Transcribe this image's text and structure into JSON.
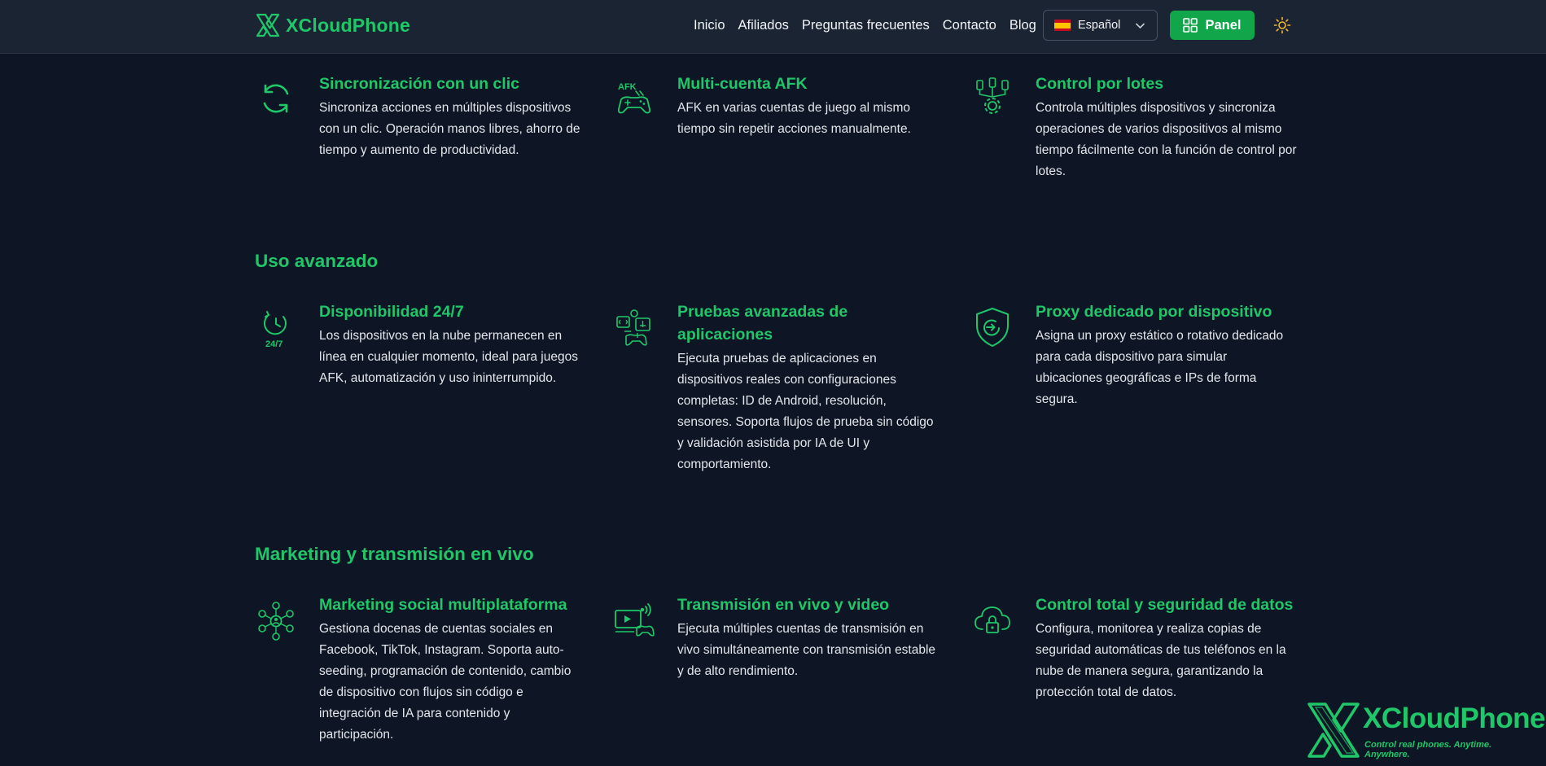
{
  "header": {
    "brand": "XCloudPhone",
    "nav": [
      "Inicio",
      "Afiliados",
      "Preguntas frecuentes",
      "Contacto",
      "Blog"
    ],
    "language": "Español",
    "panel_label": "Panel"
  },
  "sections": [
    {
      "title": "",
      "features": [
        {
          "icon": "sync-icon",
          "title": "Sincronización con un clic",
          "text": "Sincroniza acciones en múltiples dispositivos con un clic. Operación manos libres, ahorro de tiempo y aumento de productividad."
        },
        {
          "icon": "afk-gamepad-icon",
          "icon_label": "AFK",
          "title": "Multi-cuenta AFK",
          "text": "AFK en varias cuentas de juego al mismo tiempo sin repetir acciones manualmente."
        },
        {
          "icon": "batch-control-icon",
          "title": "Control por lotes",
          "text": "Controla múltiples dispositivos y sincroniza operaciones de varios dispositivos al mismo tiempo fácilmente con la función de control por lotes."
        }
      ]
    },
    {
      "title": "Uso avanzado",
      "features": [
        {
          "icon": "clock-24-7-icon",
          "icon_label": "24/7",
          "title": "Disponibilidad 24/7",
          "text": "Los dispositivos en la nube permanecen en línea en cualquier momento, ideal para juegos AFK, automatización y uso ininterrumpido."
        },
        {
          "icon": "app-testing-icon",
          "title": "Pruebas avanzadas de aplicaciones",
          "text": "Ejecuta pruebas de aplicaciones en dispositivos reales con configuraciones completas: ID de Android, resolución, sensores. Soporta flujos de prueba sin código y validación asistida por IA de UI y comportamiento."
        },
        {
          "icon": "shield-proxy-icon",
          "title": "Proxy dedicado por dispositivo",
          "text": "Asigna un proxy estático o rotativo dedicado para cada dispositivo para simular ubicaciones geográficas e IPs de forma segura."
        }
      ]
    },
    {
      "title": "Marketing y transmisión en vivo",
      "features": [
        {
          "icon": "social-network-icon",
          "title": "Marketing social multiplataforma",
          "text": "Gestiona docenas de cuentas sociales en Facebook, TikTok, Instagram. Soporta auto-seeding, programación de contenido, cambio de dispositivo con flujos sin código e integración de IA para contenido y participación."
        },
        {
          "icon": "live-stream-icon",
          "title": "Transmisión en vivo y video",
          "text": "Ejecuta múltiples cuentas de transmisión en vivo simultáneamente con transmisión estable y de alto rendimiento."
        },
        {
          "icon": "cloud-lock-icon",
          "title": "Control total y seguridad de datos",
          "text": "Configura, monitorea y realiza copias de seguridad automáticas de tus teléfonos en la nube de manera segura, garantizando la protección total de datos."
        }
      ]
    }
  ],
  "watermark": {
    "brand": "XCloudPhone",
    "tagline": "Control real phones. Anytime. Anywhere."
  },
  "colors": {
    "accent": "#1fc768",
    "background": "#0e1626",
    "header": "#1a2433",
    "button": "#12a64b"
  }
}
